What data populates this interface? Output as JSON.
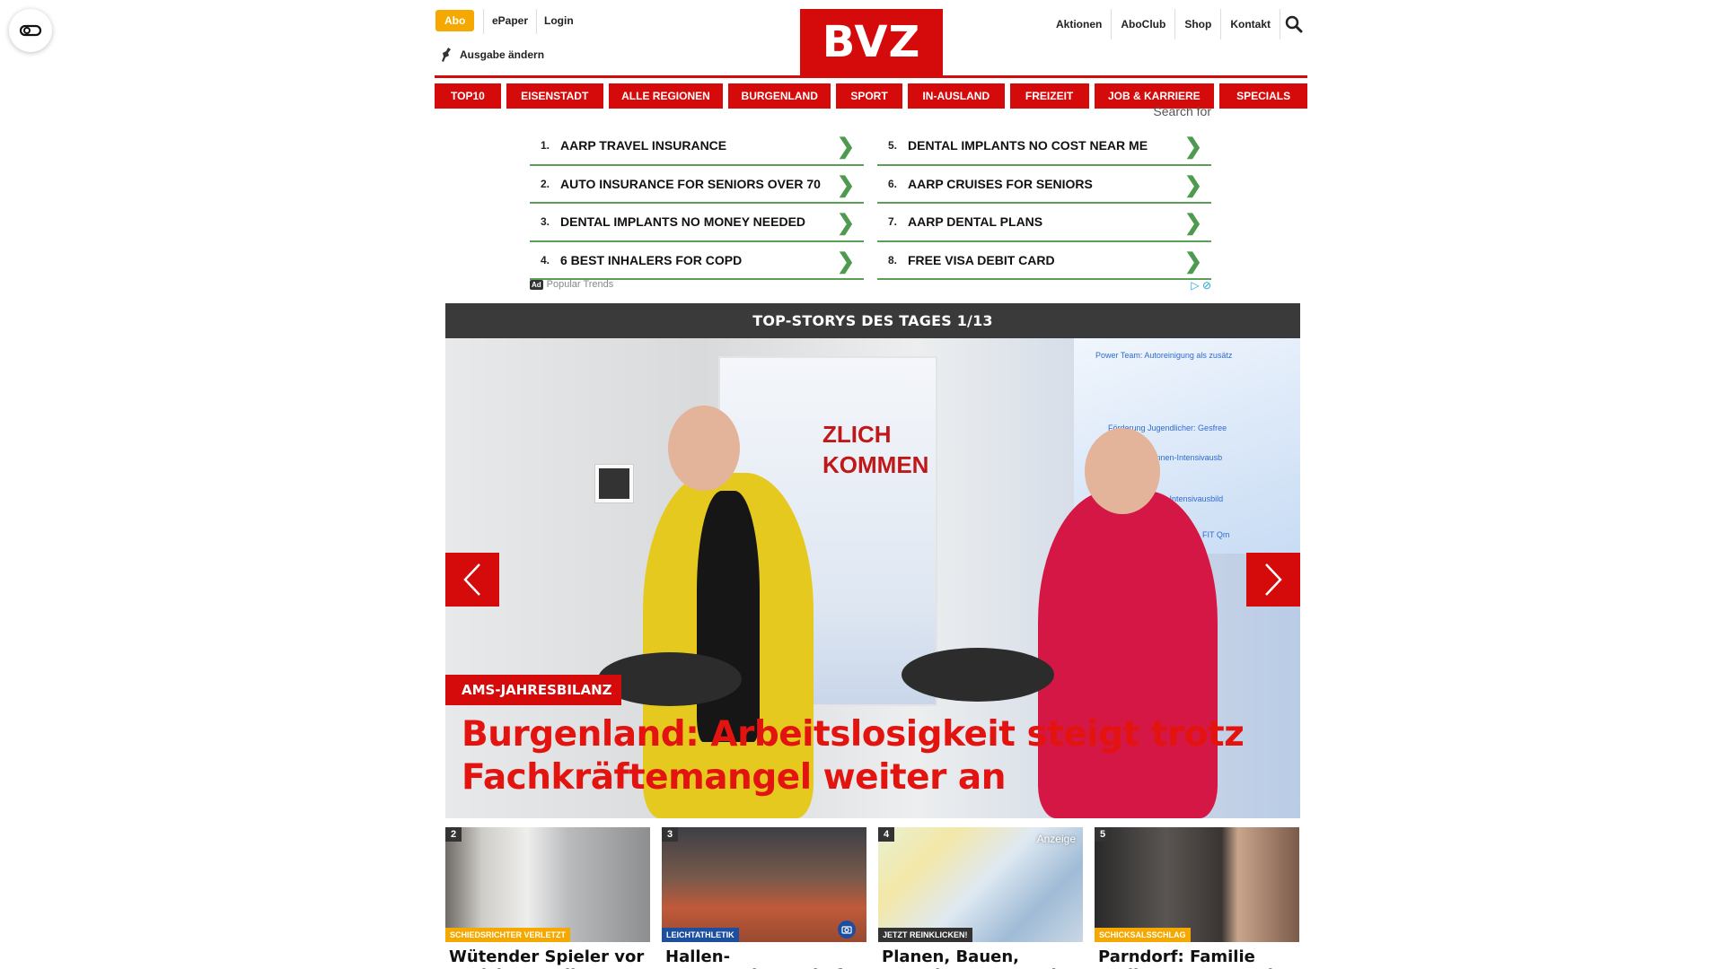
{
  "header": {
    "abo_label": "Abo",
    "epaper_label": "ePaper",
    "login_label": "Login",
    "edition_label": "Ausgabe ändern",
    "logo_text": "BVZ",
    "right_links": [
      "Aktionen",
      "AboClub",
      "Shop",
      "Kontakt"
    ]
  },
  "nav": {
    "items": [
      "TOP10",
      "EISENSTADT",
      "ALLE REGIONEN",
      "BURGENLAND",
      "SPORT",
      "IN-AUSLAND",
      "FREIZEIT",
      "JOB & KARRIERE",
      "SPECIALS"
    ]
  },
  "ad": {
    "search_label": "Search for",
    "left": [
      {
        "num": "1.",
        "text": "AARP TRAVEL INSURANCE"
      },
      {
        "num": "2.",
        "text": "AUTO INSURANCE FOR SENIORS OVER 70"
      },
      {
        "num": "3.",
        "text": "DENTAL IMPLANTS NO MONEY NEEDED"
      },
      {
        "num": "4.",
        "text": "6 BEST INHALERS FOR COPD"
      }
    ],
    "right": [
      {
        "num": "5.",
        "text": "DENTAL IMPLANTS NO COST NEAR ME"
      },
      {
        "num": "6.",
        "text": "AARP CRUISES FOR SENIORS"
      },
      {
        "num": "7.",
        "text": "AARP DENTAL PLANS"
      },
      {
        "num": "8.",
        "text": "FREE VISA DEBIT CARD"
      }
    ],
    "badge": "Ad",
    "footer": "Popular Trends"
  },
  "stories": {
    "heading": "TOP-STORYS DES TAGES 1/13",
    "hero_kicker": "AMS-JAHRESBILANZ",
    "hero_title": "Burgenland: Arbeitslosigkeit steigt trotz Fachkräftemangel weiter an",
    "banner_line1": "ZLICH",
    "banner_line2": "KOMMEN",
    "screen_lines": [
      "Power Team: Autoreinigung als zusätz",
      "Förderung Jugendlicher: Gesfree",
      "Facharbeiter_innen-Intensivausb",
      "Facharbeiter_innen-Intensivausbild",
      "(Qualifizierung mit System), FIT Qm"
    ]
  },
  "teasers": [
    {
      "num": "2",
      "kicker": "SCHIEDSRICHTER VERLETZT",
      "kicker_color": "#f5a800",
      "title": "Wütender Spieler vor Gericht: „Weil er meine"
    },
    {
      "num": "3",
      "kicker": "LEICHTATHLETIK",
      "kicker_color": "#1d4fa0",
      "title": "Hallen-Staatsmeisterschaften:"
    },
    {
      "num": "4",
      "kicker": "JETZT REINKLICKEN!",
      "kicker_color": "#333333",
      "anzeige": "Anzeige",
      "title": "Planen, Bauen, Energie sparen - Hier geht's zum"
    },
    {
      "num": "5",
      "kicker": "SCHICKSALSSCHLAG",
      "kicker_color": "#f5a800",
      "title": "Parndorf: Familie verliert Mutter und Heim –"
    }
  ],
  "colors": {
    "brand_red": "#d50b0b",
    "abo_orange": "#f5a800",
    "ad_green": "#5a9e5a"
  }
}
